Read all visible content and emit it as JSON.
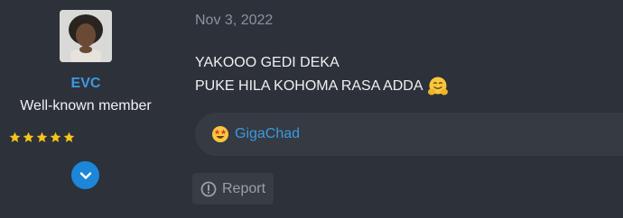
{
  "user": {
    "name": "EVC",
    "title": "Well-known member",
    "rating_stars": 5
  },
  "post": {
    "date": "Nov 3, 2022",
    "lines": [
      "YAKOOO GEDI DEKA",
      "PUKE HILA KOHOMA RASA ADDA"
    ]
  },
  "reactions": {
    "user": "GigaChad",
    "emoji": "star-struck-emoji"
  },
  "actions": {
    "report_label": "Report"
  },
  "colors": {
    "background": "#2d313a",
    "accent": "#3b9ae0",
    "star": "#f5c518",
    "expand_button": "#1c86d8"
  }
}
